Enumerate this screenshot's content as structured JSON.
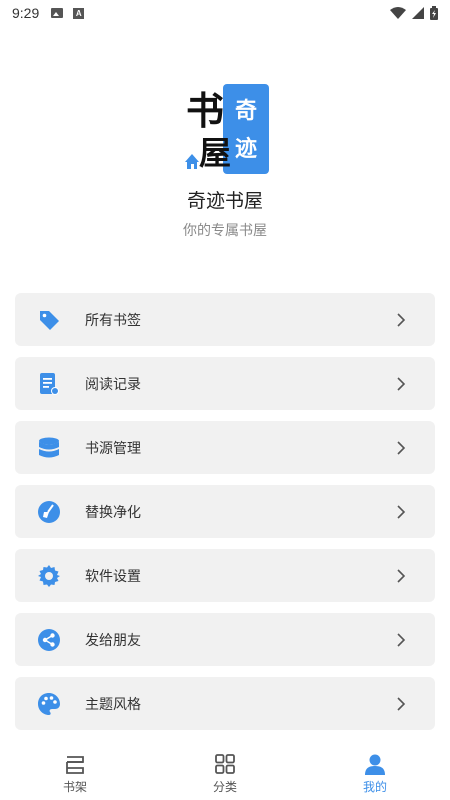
{
  "status_bar": {
    "time": "9:29",
    "icons": [
      "image-icon",
      "a-icon",
      "wifi-icon",
      "signal-icon",
      "battery-icon"
    ]
  },
  "header": {
    "logo_text_primary": "书屋",
    "logo_text_secondary": "奇迹",
    "app_name": "奇迹书屋",
    "slogan": "你的专属书屋"
  },
  "menu": {
    "items": [
      {
        "label": "所有书签",
        "icon": "tag-icon"
      },
      {
        "label": "阅读记录",
        "icon": "reading-history-icon"
      },
      {
        "label": "书源管理",
        "icon": "database-icon"
      },
      {
        "label": "替换净化",
        "icon": "clean-brush-icon"
      },
      {
        "label": "软件设置",
        "icon": "gear-icon"
      },
      {
        "label": "发给朋友",
        "icon": "share-icon"
      },
      {
        "label": "主题风格",
        "icon": "palette-icon"
      }
    ]
  },
  "bottom_nav": {
    "items": [
      {
        "label": "书架",
        "icon": "bookshelf-icon",
        "active": false
      },
      {
        "label": "分类",
        "icon": "grid-icon",
        "active": false
      },
      {
        "label": "我的",
        "icon": "user-icon",
        "active": true
      }
    ]
  },
  "colors": {
    "accent": "#3d8fe8",
    "menu_bg": "#f1f1f1",
    "text": "#333333",
    "muted": "#8a8a8a"
  }
}
